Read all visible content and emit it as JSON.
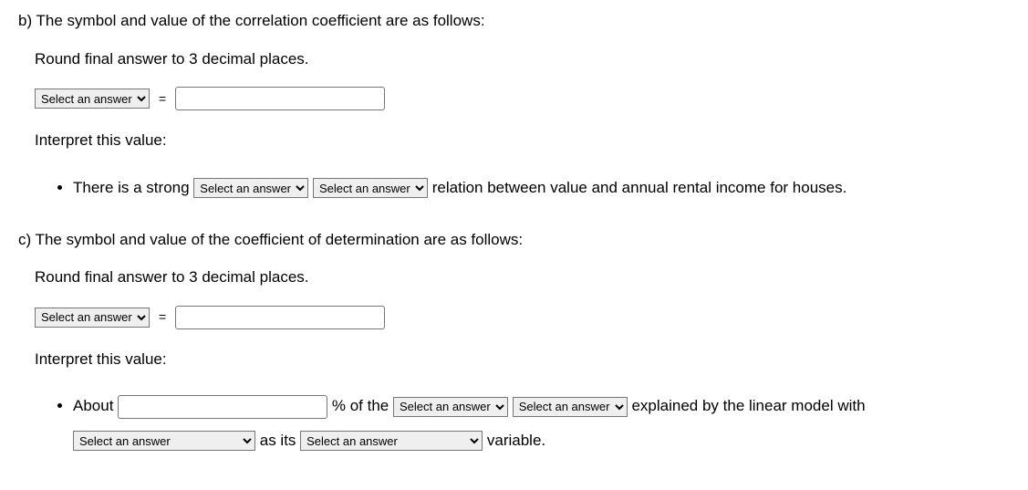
{
  "partB": {
    "title": "b) The symbol and value of the correlation coefficient are as follows:",
    "round": "Round final answer to 3 decimal places.",
    "selectPlaceholder": "Select an answer",
    "equals": "=",
    "interpret": "Interpret this value:",
    "bullet": {
      "pre": "There is a strong ",
      "sel1": "Select an answer",
      "sel2": "Select an answer",
      "mid": " relation between value and annual rental income for houses."
    }
  },
  "partC": {
    "title": "c) The symbol and value of the coefficient of determination are as follows:",
    "round": "Round final answer to 3 decimal places.",
    "selectPlaceholder": "Select an answer",
    "equals": "=",
    "interpret": "Interpret this value:",
    "bullet": {
      "aboutLabel": "About ",
      "pctOf": " % of the ",
      "sel1": "Select an answer",
      "sel2": "Select an answer",
      "explained": " explained by the linear model with ",
      "sel3": "Select an answer",
      "asIts": " as its ",
      "sel4": "Select an answer",
      "variable": " variable."
    }
  }
}
